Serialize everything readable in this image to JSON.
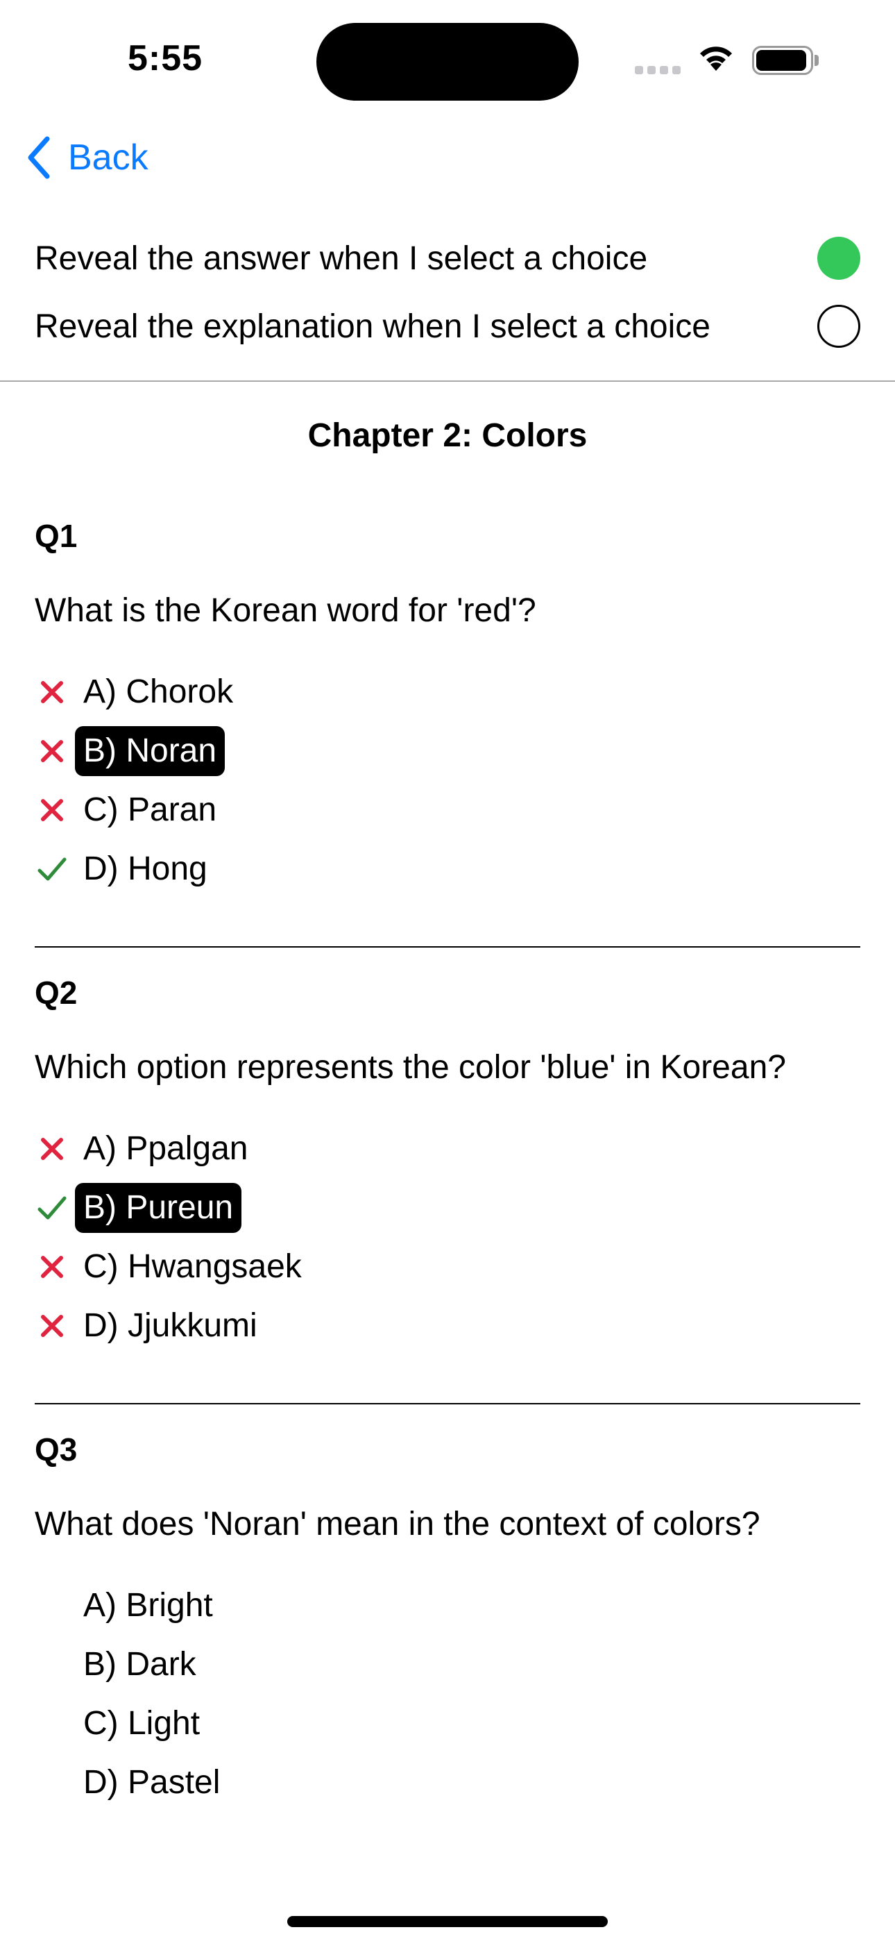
{
  "status": {
    "time": "5:55"
  },
  "nav": {
    "back_label": "Back"
  },
  "settings": {
    "reveal_answer_label": "Reveal the answer when I select a choice",
    "reveal_answer_on": true,
    "reveal_explanation_label": "Reveal the explanation when I select a choice",
    "reveal_explanation_on": false
  },
  "chapter": {
    "title": "Chapter 2: Colors"
  },
  "colors": {
    "accent": "#0a7aff",
    "toggle_on": "#34c759",
    "wrong": "#e0243f",
    "correct": "#2e8b3a"
  },
  "questions": [
    {
      "id": "Q1",
      "text": "What is the Korean word for 'red'?",
      "options": [
        {
          "label": "A) Chorok",
          "mark": "x-icon",
          "selected": false
        },
        {
          "label": "B) Noran",
          "mark": "x-icon",
          "selected": true
        },
        {
          "label": "C) Paran",
          "mark": "x-icon",
          "selected": false
        },
        {
          "label": "D) Hong",
          "mark": "check-icon",
          "selected": false
        }
      ]
    },
    {
      "id": "Q2",
      "text": "Which option represents the color 'blue' in Korean?",
      "options": [
        {
          "label": "A) Ppalgan",
          "mark": "x-icon",
          "selected": false
        },
        {
          "label": "B) Pureun",
          "mark": "check-icon",
          "selected": true
        },
        {
          "label": "C) Hwangsaek",
          "mark": "x-icon",
          "selected": false
        },
        {
          "label": "D) Jjukkumi",
          "mark": "x-icon",
          "selected": false
        }
      ]
    },
    {
      "id": "Q3",
      "text": "What does 'Noran' mean in the context of colors?",
      "options": [
        {
          "label": "A) Bright",
          "mark": "",
          "selected": false
        },
        {
          "label": "B) Dark",
          "mark": "",
          "selected": false
        },
        {
          "label": "C) Light",
          "mark": "",
          "selected": false
        },
        {
          "label": "D) Pastel",
          "mark": "",
          "selected": false
        }
      ]
    }
  ]
}
